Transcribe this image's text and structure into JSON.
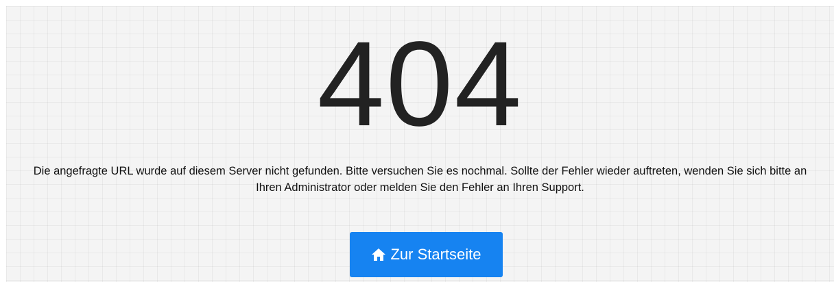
{
  "error": {
    "code": "404",
    "message": "Die angefragte URL wurde auf diesem Server nicht gefunden. Bitte versuchen Sie es nochmal. Sollte der Fehler wieder auftreten, wenden Sie sich bitte an Ihren Administrator oder melden Sie den Fehler an Ihren Support."
  },
  "home_button": {
    "label": "Zur Startseite",
    "icon": "home-icon",
    "color": "#1683f1"
  }
}
